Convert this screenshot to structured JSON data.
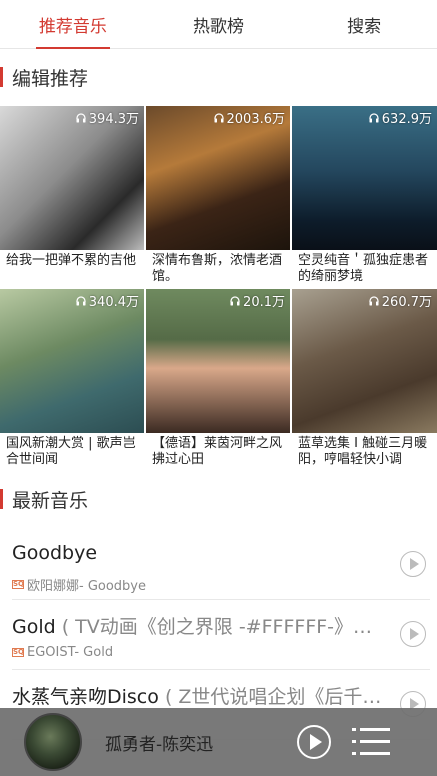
{
  "tabs": [
    {
      "label": "推荐音乐",
      "active": true
    },
    {
      "label": "热歌榜",
      "active": false
    },
    {
      "label": "搜索",
      "active": false
    }
  ],
  "sections": {
    "recommend_title": "编辑推荐",
    "latest_title": "最新音乐"
  },
  "playlists": [
    {
      "count": "394.3万",
      "title": "给我一把弹不累的吉他"
    },
    {
      "count": "2003.6万",
      "title": "深情布鲁斯，浓情老酒馆。"
    },
    {
      "count": "632.9万",
      "title": "空灵纯音＇孤独症患者的绮丽梦境"
    },
    {
      "count": "340.4万",
      "title": "国风新潮大赏 | 歌声岂合世间闻"
    },
    {
      "count": "20.1万",
      "title": "【德语】莱茵河畔之风拂过心田"
    },
    {
      "count": "260.7万",
      "title": "蓝草选集 I 触碰三月暖阳，哼唱轻快小调"
    }
  ],
  "songs": [
    {
      "name": "Goodbye",
      "alias": "",
      "sub": "欧阳娜娜- Goodbye"
    },
    {
      "name": "Gold",
      "alias": "( TV动画《创之界限 -#FFFFFF-》…",
      "sub": "EGOIST- Gold"
    },
    {
      "name": "水蒸气亲吻Disco",
      "alias": "( Z世代说唱企划《后千…",
      "sub": ""
    }
  ],
  "sq_badge": "SQ",
  "player": {
    "now_playing": "孤勇者-陈奕迅"
  },
  "icons": {
    "headphone": "headphone-icon",
    "play": "play-icon",
    "playlist": "playlist-icon"
  },
  "colors": {
    "accent": "#d33a31",
    "sq": "#e07a50",
    "player_bg": "#6e6e6e"
  }
}
